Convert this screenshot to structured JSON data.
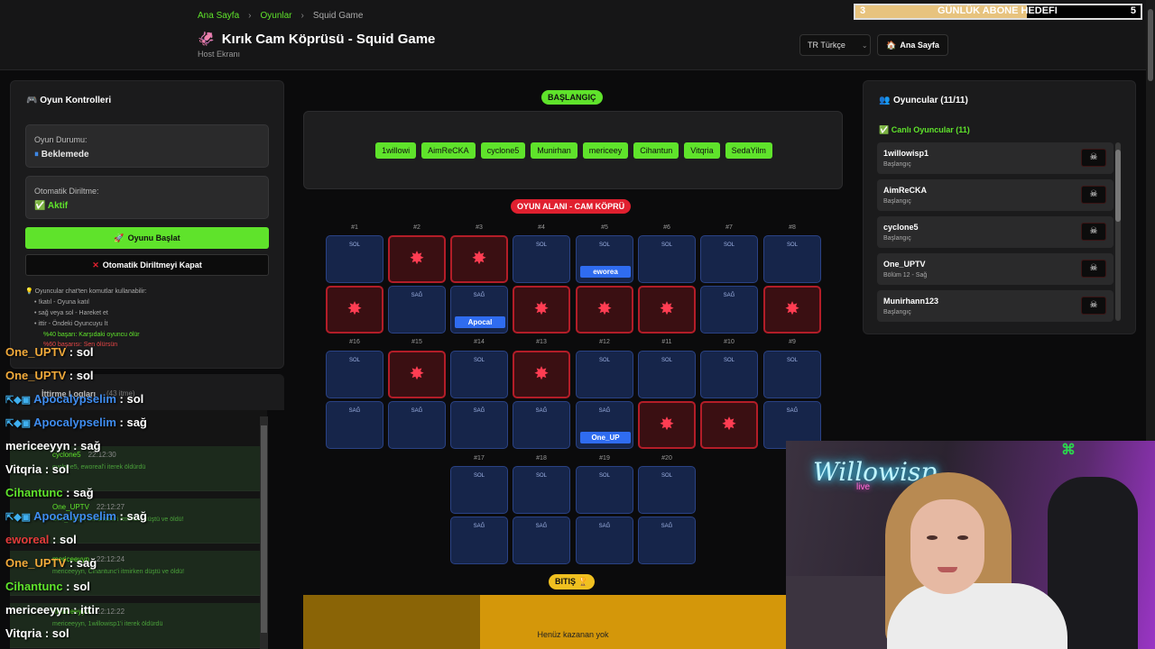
{
  "breadcrumb": {
    "home": "Ana Sayfa",
    "games": "Oyunlar",
    "current": "Squid Game"
  },
  "page": {
    "title": "Kırık Cam Köprüsü - Squid Game",
    "subtitle": "Host Ekranı",
    "title_icon": "🦑"
  },
  "header": {
    "lang_label": "TR Türkçe",
    "home_button": "Ana Sayfa"
  },
  "goal": {
    "current": "3",
    "label": "GÜNLÜK ABONE HEDEFI",
    "target": "5",
    "progress": 0.6
  },
  "controls": {
    "title": "Oyun Kontrolleri",
    "status_label": "Oyun Durumu:",
    "status_value": "Beklemede",
    "revive_label": "Otomatik Diriltme:",
    "revive_value": "Aktif",
    "start_button": "Oyunu Başlat",
    "revive_button": "Otomatik Diriltmeyi Kapat",
    "help_lines": [
      "Oyuncular chat'ten komutlar kullanabilir:",
      "!katıl - Oyuna katıl",
      "sağ veya sol - Hareket et",
      "ittir - Öndeki Oyuncuyu İt",
      "%40 başarı: Karşıdaki oyuncu ölür",
      "%60 başarısı: Sen ölürsün"
    ]
  },
  "logs": {
    "title": "İttirme Logları",
    "count": "(43 itme)",
    "rows": [
      {
        "name": "cyclone5",
        "time": "22:12:30",
        "msg": "cyclone5, eworeal'i iterek öldürdü"
      },
      {
        "name": "One_UPTV",
        "time": "22:12:27",
        "msg": "One_UPTV, Cihantunc'i itmirken düştü ve öldü!"
      },
      {
        "name": "mericeeyyn",
        "time": "22:12:24",
        "msg": "mericeeyyn, Cihantunc'i itmirken düştü ve öldü!"
      },
      {
        "name": "mericeeyyn",
        "time": "22:12:22",
        "msg": "mericeeyyn, 1willowisp1'i iterek öldürdü"
      }
    ]
  },
  "chat": [
    {
      "user": "One_UPTV",
      "msg": "sol",
      "color": "#f0a93a",
      "badges": false
    },
    {
      "user": "One_UPTV",
      "msg": "sol",
      "color": "#f0a93a",
      "badges": false
    },
    {
      "user": "Apocalypselim",
      "msg": "sol",
      "color": "#3f8df0",
      "badges": true
    },
    {
      "user": "Apocalypselim",
      "msg": "sağ",
      "color": "#3f8df0",
      "badges": true
    },
    {
      "user": "mericeeyyn",
      "msg": "sağ",
      "color": "#ffffff",
      "badges": false
    },
    {
      "user": "Vitqria",
      "msg": "sol",
      "color": "#ffffff",
      "badges": false
    },
    {
      "user": "Cihantunc",
      "msg": "sağ",
      "color": "#5fe32b",
      "badges": false
    },
    {
      "user": "Apocalypselim",
      "msg": "sağ",
      "color": "#3f8df0",
      "badges": true
    },
    {
      "user": "eworeal",
      "msg": "sol",
      "color": "#e33b3b",
      "badges": false
    },
    {
      "user": "One_UPTV",
      "msg": "sağ",
      "color": "#f0a93a",
      "badges": false
    },
    {
      "user": "Cihantunc",
      "msg": "sol",
      "color": "#5fe32b",
      "badges": false
    },
    {
      "user": "mericeeyyn",
      "msg": "ittir",
      "color": "#ffffff",
      "badges": false
    },
    {
      "user": "Vitqria",
      "msg": "sol",
      "color": "#ffffff",
      "badges": false
    }
  ],
  "start": {
    "label": "BAŞLANGIÇ",
    "players": [
      "1willowi",
      "AimReCKA",
      "cyclone5",
      "Munirhan",
      "mericeey",
      "Cihantun",
      "Vitqria",
      "SedaYilm"
    ]
  },
  "board": {
    "label": "OYUN ALANI - CAM KÖPRÜ",
    "left": "SOL",
    "right": "SAĞ",
    "rows": [
      {
        "steps": [
          {
            "num": "#1",
            "sol": "ok",
            "sag": "broken"
          },
          {
            "num": "#2",
            "sol": "broken",
            "sag": "ok"
          },
          {
            "num": "#3",
            "sol": "broken",
            "sag": "ok",
            "sag_player": "Apocal"
          },
          {
            "num": "#4",
            "sol": "ok",
            "sag": "broken"
          },
          {
            "num": "#5",
            "sol": "ok",
            "sag": "broken",
            "sol_player": "eworea"
          },
          {
            "num": "#6",
            "sol": "ok",
            "sag": "broken"
          },
          {
            "num": "#7",
            "sol": "ok",
            "sag": "ok"
          },
          {
            "num": "#8",
            "sol": "ok",
            "sag": "broken"
          }
        ]
      },
      {
        "steps": [
          {
            "num": "#16",
            "sol": "ok",
            "sag": "ok"
          },
          {
            "num": "#15",
            "sol": "broken",
            "sag": "ok"
          },
          {
            "num": "#14",
            "sol": "ok",
            "sag": "ok"
          },
          {
            "num": "#13",
            "sol": "broken",
            "sag": "ok"
          },
          {
            "num": "#12",
            "sol": "ok",
            "sag": "ok",
            "sag_player": "One_UP"
          },
          {
            "num": "#11",
            "sol": "ok",
            "sag": "broken"
          },
          {
            "num": "#10",
            "sol": "ok",
            "sag": "broken"
          },
          {
            "num": "#9",
            "sol": "ok",
            "sag": "ok"
          }
        ]
      },
      {
        "steps": [
          {
            "num": "#17",
            "sol": "ok",
            "sag": "ok"
          },
          {
            "num": "#18",
            "sol": "ok",
            "sag": "ok"
          },
          {
            "num": "#19",
            "sol": "ok",
            "sag": "ok"
          },
          {
            "num": "#20",
            "sol": "ok",
            "sag": "ok"
          }
        ]
      }
    ]
  },
  "finish": {
    "label": "BITIŞ",
    "winner_text": "Henüz kazanan yok"
  },
  "players_panel": {
    "title": "Oyuncular (11/11)",
    "live_label": "Canlı Oyuncular (11)",
    "players": [
      {
        "name": "1willowisp1",
        "status": "Başlangıç"
      },
      {
        "name": "AimReCKA",
        "status": "Başlangıç"
      },
      {
        "name": "cyclone5",
        "status": "Başlangıç"
      },
      {
        "name": "One_UPTV",
        "status": "Bölüm 12 - Sağ"
      },
      {
        "name": "Munirhann123",
        "status": "Başlangıç"
      }
    ]
  },
  "webcam": {
    "neon_text": "Willowisp",
    "neon_sub": "live"
  },
  "colors": {
    "accent": "#5fe32b",
    "danger": "#e0202f",
    "tile": "#16254a",
    "gold": "#d4970a"
  }
}
